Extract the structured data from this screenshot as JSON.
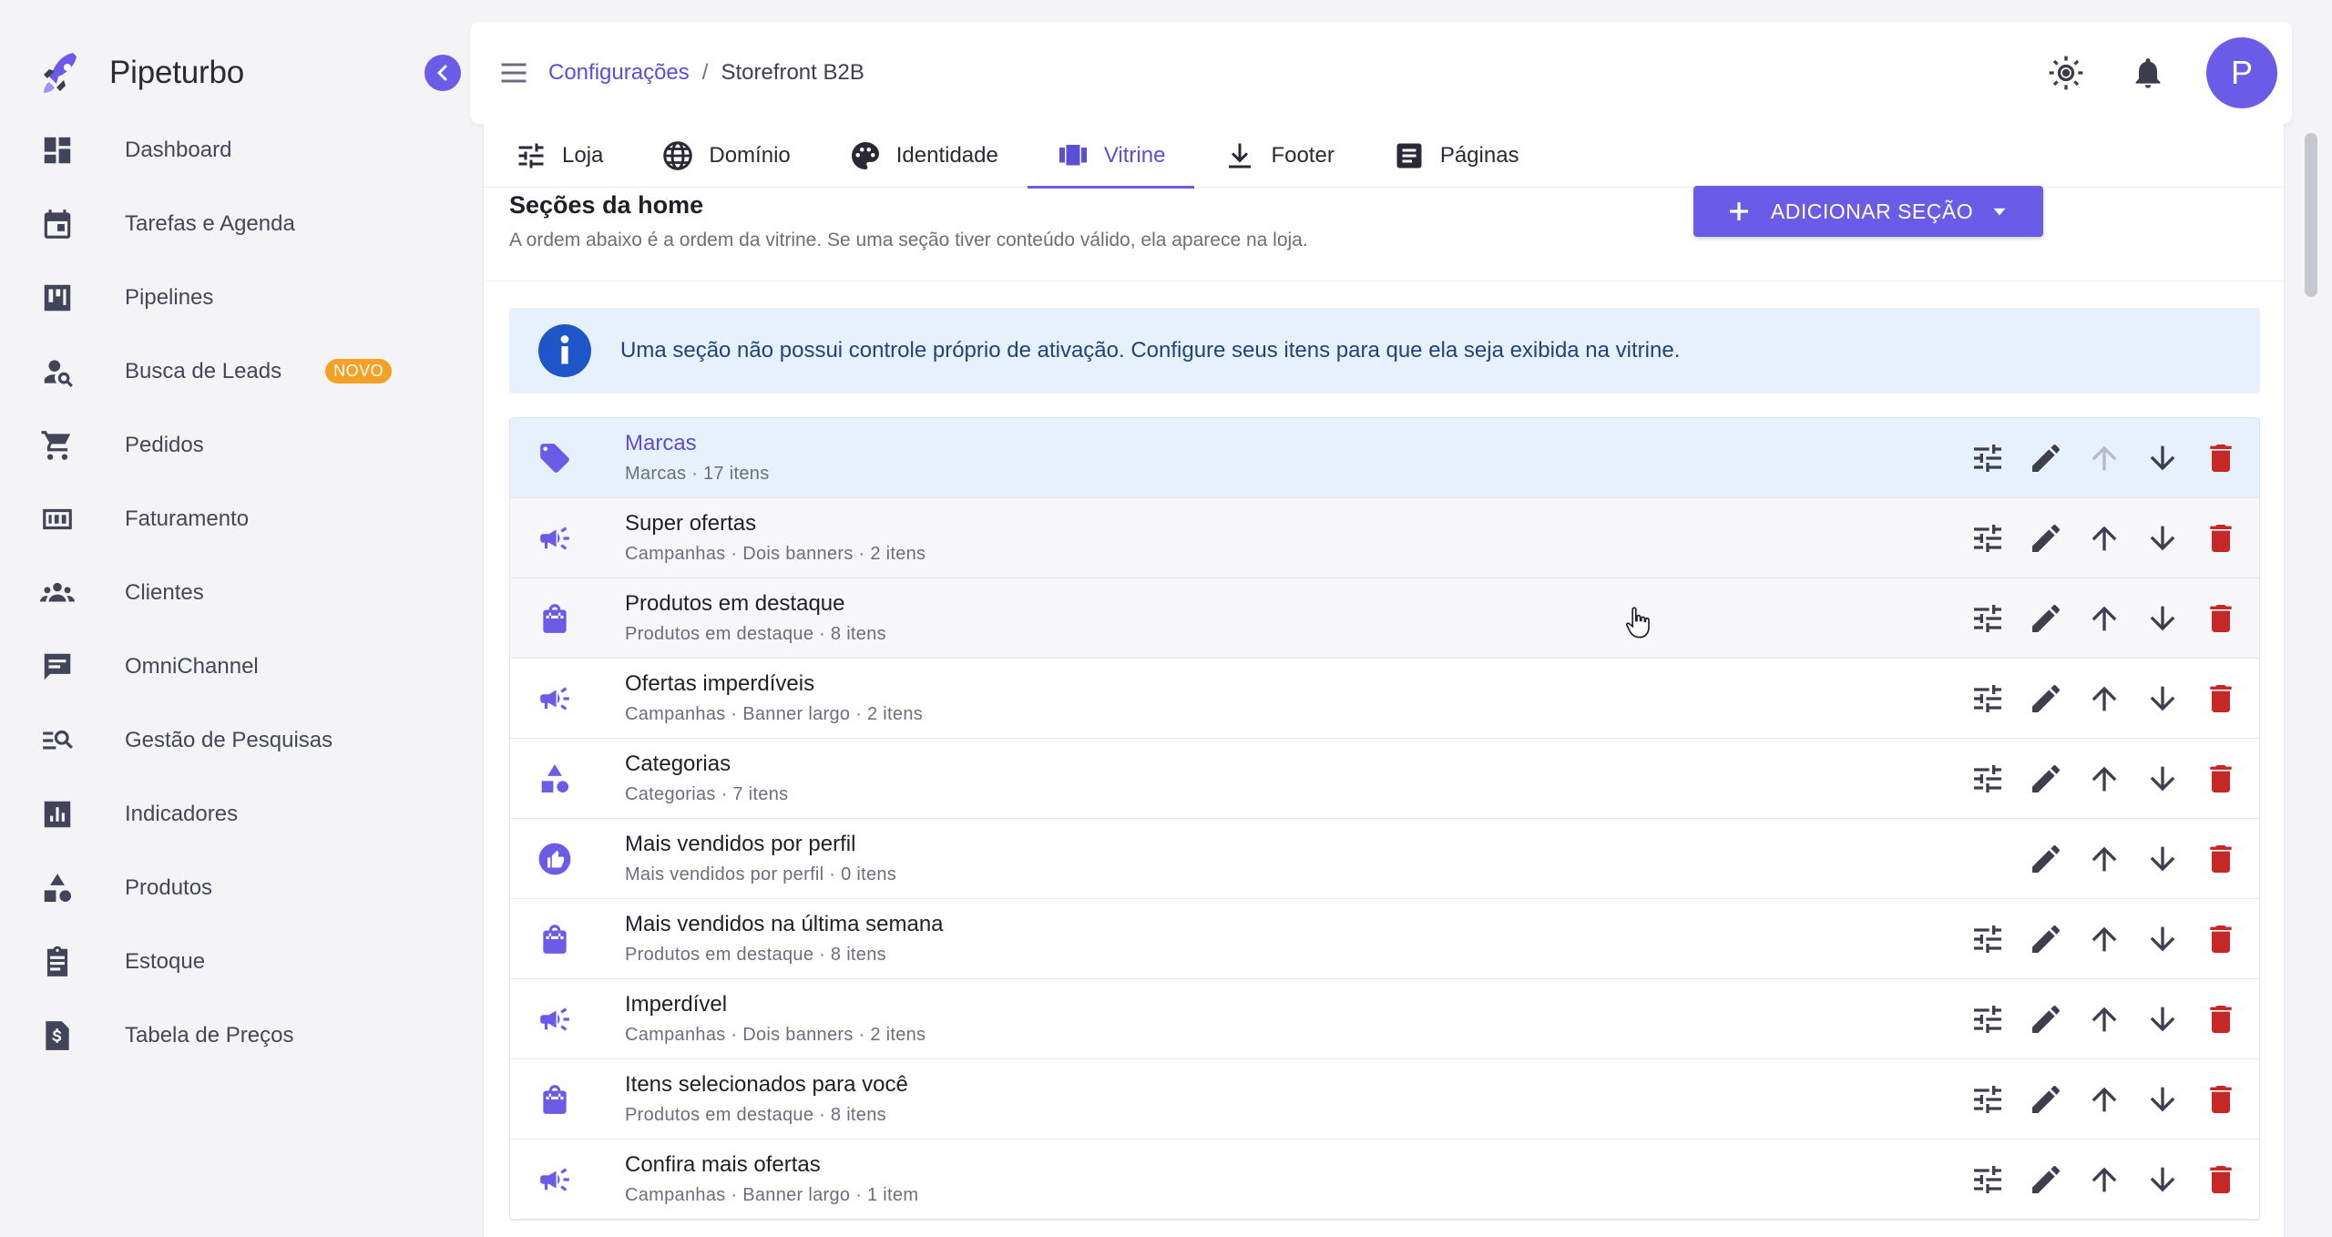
{
  "brand": {
    "name": "Pipeturbo"
  },
  "sidebar": {
    "items": [
      {
        "label": "Dashboard",
        "icon": "dashboard-icon"
      },
      {
        "label": "Tarefas e Agenda",
        "icon": "calendar-icon"
      },
      {
        "label": "Pipelines",
        "icon": "kanban-icon"
      },
      {
        "label": "Busca de Leads",
        "icon": "person-search-icon",
        "badge": "NOVO"
      },
      {
        "label": "Pedidos",
        "icon": "cart-icon"
      },
      {
        "label": "Faturamento",
        "icon": "invoice-icon"
      },
      {
        "label": "Clientes",
        "icon": "group-icon"
      },
      {
        "label": "OmniChannel",
        "icon": "chat-icon"
      },
      {
        "label": "Gestão de Pesquisas",
        "icon": "manage-search-icon"
      },
      {
        "label": "Indicadores",
        "icon": "analytics-icon"
      },
      {
        "label": "Produtos",
        "icon": "category-icon"
      },
      {
        "label": "Estoque",
        "icon": "clipboard-icon"
      },
      {
        "label": "Tabela de Preços",
        "icon": "price-doc-icon"
      }
    ]
  },
  "header": {
    "breadcrumb_parent": "Configurações",
    "breadcrumb_sep": "/",
    "breadcrumb_current": "Storefront B2B",
    "avatar_initial": "P"
  },
  "tabs": [
    {
      "label": "Loja",
      "icon": "tune-icon"
    },
    {
      "label": "Domínio",
      "icon": "globe-icon"
    },
    {
      "label": "Identidade",
      "icon": "palette-icon"
    },
    {
      "label": "Vitrine",
      "icon": "carousel-icon",
      "active": true
    },
    {
      "label": "Footer",
      "icon": "download-icon"
    },
    {
      "label": "Páginas",
      "icon": "article-icon"
    }
  ],
  "section": {
    "title": "Seções da home",
    "subtitle": "A ordem abaixo é a ordem da vitrine. Se uma seção tiver conteúdo válido, ela aparece na loja.",
    "add_button": "ADICIONAR SEÇÃO"
  },
  "info_text": "Uma seção não possui controle próprio de ativação. Configure seus itens para que ela seja exibida na vitrine.",
  "colors": {
    "accent": "#6b5ce7",
    "danger": "#c62828",
    "info_bg": "#e6f1fb"
  },
  "rows": [
    {
      "title": "Marcas",
      "meta": "Marcas · 17 itens",
      "icon": "tag-icon"
    },
    {
      "title": "Super ofertas",
      "meta": "Campanhas · Dois banners · 2 itens",
      "icon": "campaign-icon"
    },
    {
      "title": "Produtos em destaque",
      "meta": "Produtos em destaque · 8 itens",
      "icon": "shopping-bag-icon"
    },
    {
      "title": "Ofertas imperdíveis",
      "meta": "Campanhas · Banner largo · 2 itens",
      "icon": "campaign-icon"
    },
    {
      "title": "Categorias",
      "meta": "Categorias · 7 itens",
      "icon": "category-icon"
    },
    {
      "title": "Mais vendidos por perfil",
      "meta": "Mais vendidos por perfil · 0 itens",
      "icon": "thumb-up-icon"
    },
    {
      "title": "Mais vendidos na última semana",
      "meta": "Produtos em destaque · 8 itens",
      "icon": "shopping-bag-icon"
    },
    {
      "title": "Imperdível",
      "meta": "Campanhas · Dois banners · 2 itens",
      "icon": "campaign-icon"
    },
    {
      "title": "Itens selecionados para você",
      "meta": "Produtos em destaque · 8 itens",
      "icon": "shopping-bag-icon"
    },
    {
      "title": "Confira mais ofertas",
      "meta": "Campanhas · Banner largo · 1 item",
      "icon": "campaign-icon"
    }
  ]
}
